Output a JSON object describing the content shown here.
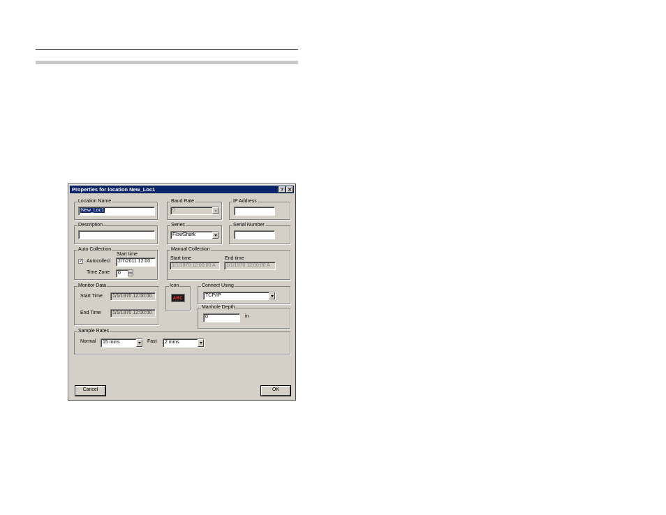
{
  "dialog": {
    "title": "Properties for location New_Loc1",
    "help_glyph": "?",
    "close_glyph": "✕"
  },
  "location_name": {
    "label": "Location Name",
    "value": "New_Loc1"
  },
  "baud_rate": {
    "label": "Baud Rate",
    "value": "0"
  },
  "ip_address": {
    "label": "IP Address",
    "value": ""
  },
  "description": {
    "label": "Description",
    "value": ""
  },
  "series": {
    "label": "Series",
    "value": "FlowShark"
  },
  "serial_number": {
    "label": "Serial Number",
    "value": ""
  },
  "auto_collection": {
    "label": "Auto Collection",
    "autocollect_label": "Autocollect",
    "autocollect_checked": true,
    "check_glyph": "✓",
    "start_time_label": "Start time",
    "start_time_value": "2/7/2011 12:00:",
    "time_zone_label": "Time Zone",
    "time_zone_value": "0"
  },
  "manual_collection": {
    "label": "Manual Collection",
    "start_time_label": "Start time",
    "start_time_value": "1/1/1970 12:00:00 A",
    "end_time_label": "End time",
    "end_time_value": "1/1/1970 12:00:00 A"
  },
  "monitor_data": {
    "label": "Monitor Data",
    "start_time_label": "Start Time",
    "start_time_value": "1/1/1970 12:00:00",
    "end_time_label": "End Time",
    "end_time_value": "1/1/1970 12:00:00"
  },
  "icon_group": {
    "label": "Icon",
    "icon_text": "ABC",
    "icon_name": "device-display-icon"
  },
  "connect_using": {
    "label": "Connect Using",
    "value": "TCP/IP"
  },
  "manhole_depth": {
    "label": "Manhole Depth",
    "value": "0",
    "unit": "in"
  },
  "sample_rates": {
    "label": "Sample Rates",
    "normal_label": "Normal",
    "normal_value": "15 mins",
    "fast_label": "Fast",
    "fast_value": "2 mins"
  },
  "buttons": {
    "cancel": "Cancel",
    "ok": "OK"
  }
}
